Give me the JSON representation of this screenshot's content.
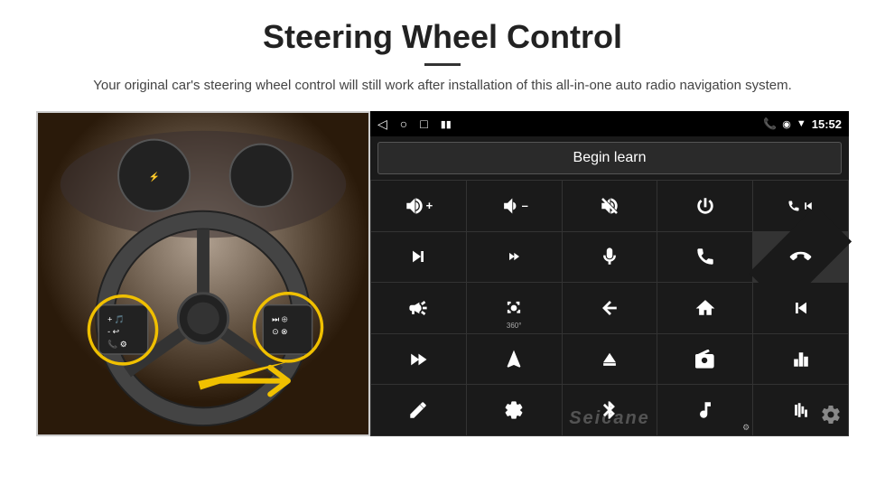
{
  "header": {
    "title": "Steering Wheel Control",
    "subtitle": "Your original car's steering wheel control will still work after installation of this all-in-one auto radio navigation system."
  },
  "status_bar": {
    "time": "15:52",
    "icons": [
      "back-arrow",
      "home-circle",
      "square",
      "battery-signal",
      "phone-icon",
      "location-icon",
      "wifi-icon"
    ]
  },
  "begin_learn": {
    "label": "Begin learn"
  },
  "control_grid": {
    "buttons": [
      {
        "id": "vol-up",
        "icon": "vol-up",
        "symbol": "🔊+"
      },
      {
        "id": "vol-down",
        "icon": "vol-down",
        "symbol": "🔉-"
      },
      {
        "id": "vol-mute",
        "icon": "vol-mute",
        "symbol": "🔇"
      },
      {
        "id": "power",
        "icon": "power",
        "symbol": "⏻"
      },
      {
        "id": "prev-track",
        "icon": "prev-track",
        "symbol": "⏮"
      },
      {
        "id": "next-track",
        "icon": "skip-forward",
        "symbol": "⏭"
      },
      {
        "id": "seek-back",
        "icon": "seek-back",
        "symbol": "⏪"
      },
      {
        "id": "mic",
        "icon": "microphone",
        "symbol": "🎤"
      },
      {
        "id": "phone",
        "icon": "phone",
        "symbol": "📞"
      },
      {
        "id": "hang-up",
        "icon": "hang-up",
        "symbol": "📵"
      },
      {
        "id": "horn",
        "icon": "horn",
        "symbol": "📢"
      },
      {
        "id": "camera-360",
        "icon": "camera-360",
        "symbol": "📷"
      },
      {
        "id": "back",
        "icon": "back",
        "symbol": "↩"
      },
      {
        "id": "home",
        "icon": "home",
        "symbol": "⌂"
      },
      {
        "id": "rewind",
        "icon": "rewind",
        "symbol": "⏮"
      },
      {
        "id": "ff",
        "icon": "fast-forward",
        "symbol": "⏭"
      },
      {
        "id": "nav",
        "icon": "navigation",
        "symbol": "▲"
      },
      {
        "id": "eject",
        "icon": "eject",
        "symbol": "⏏"
      },
      {
        "id": "radio",
        "icon": "radio",
        "symbol": "📻"
      },
      {
        "id": "equalizer",
        "icon": "equalizer",
        "symbol": "🎛"
      },
      {
        "id": "edit",
        "icon": "edit",
        "symbol": "✏"
      },
      {
        "id": "settings2",
        "icon": "settings",
        "symbol": "⚙"
      },
      {
        "id": "bluetooth",
        "icon": "bluetooth",
        "symbol": "Ⓑ"
      },
      {
        "id": "music",
        "icon": "music",
        "symbol": "🎵"
      },
      {
        "id": "waveform",
        "icon": "waveform",
        "symbol": "📊"
      }
    ]
  },
  "watermark": {
    "text": "Seicane"
  }
}
